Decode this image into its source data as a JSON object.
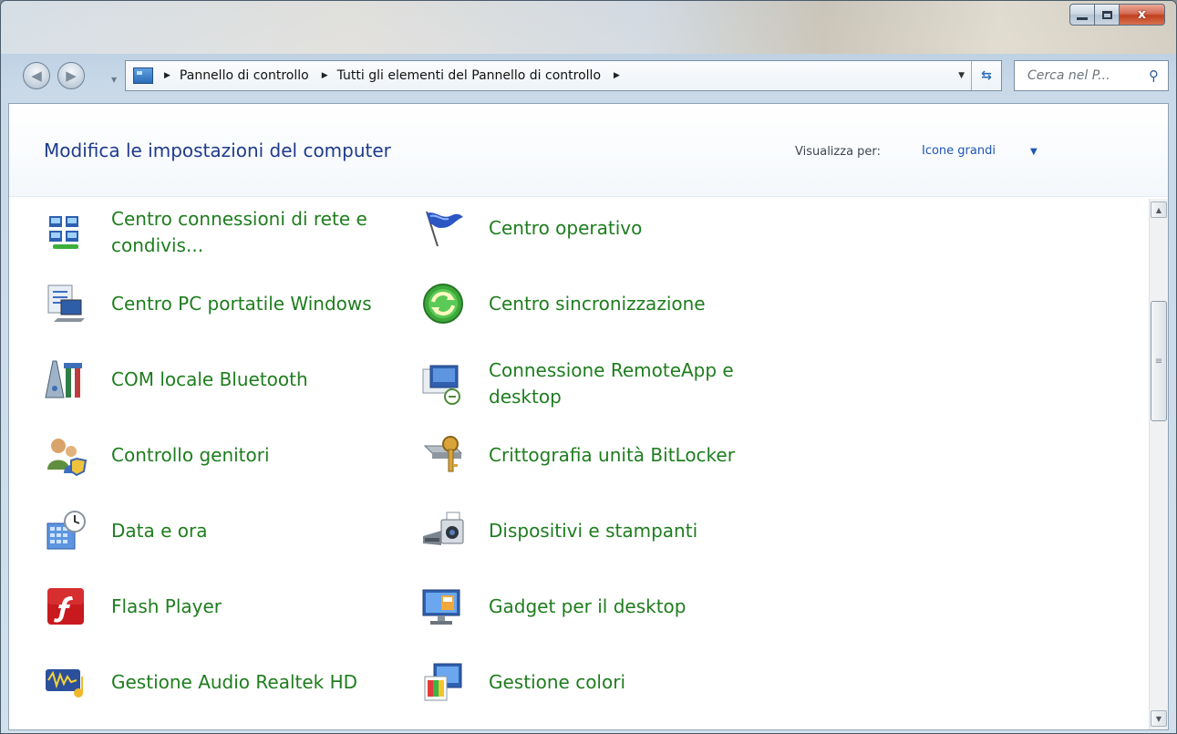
{
  "window": {
    "minimize_icon": "minimize-icon",
    "maximize_icon": "maximize-icon",
    "close_glyph": "x"
  },
  "nav": {
    "back_icon": "arrow-left-icon",
    "forward_icon": "arrow-right-icon",
    "breadcrumb": [
      "Pannello di controllo",
      "Tutti gli elementi del Pannello di controllo"
    ],
    "search_placeholder": "Cerca nel P..."
  },
  "header": {
    "title": "Modifica le impostazioni del computer",
    "view_label": "Visualizza per:",
    "view_value": "Icone grandi"
  },
  "items": [
    {
      "label": "Centro connessioni di rete e condivis...",
      "icon": "network-icon"
    },
    {
      "label": "Centro operativo",
      "icon": "flag-icon"
    },
    {
      "label": "Centro PC portatile Windows",
      "icon": "laptop-icon"
    },
    {
      "label": "Centro sincronizzazione",
      "icon": "sync-icon"
    },
    {
      "label": "COM locale Bluetooth",
      "icon": "tools-icon"
    },
    {
      "label": "Connessione RemoteApp e desktop",
      "icon": "remote-desktop-icon"
    },
    {
      "label": "Controllo genitori",
      "icon": "parental-control-icon"
    },
    {
      "label": "Crittografia unità BitLocker",
      "icon": "bitlocker-key-icon"
    },
    {
      "label": "Data e ora",
      "icon": "calendar-clock-icon"
    },
    {
      "label": "Dispositivi e stampanti",
      "icon": "printer-camera-icon"
    },
    {
      "label": "Flash Player",
      "icon": "flash-icon"
    },
    {
      "label": "Gadget per il desktop",
      "icon": "monitor-gadget-icon"
    },
    {
      "label": "Gestione Audio Realtek HD",
      "icon": "audio-wave-icon"
    },
    {
      "label": "Gestione colori",
      "icon": "color-management-icon"
    }
  ],
  "colors": {
    "title_blue": "#1e3b8a",
    "item_green": "#1e7d1e",
    "link_blue": "#1f56b5"
  }
}
